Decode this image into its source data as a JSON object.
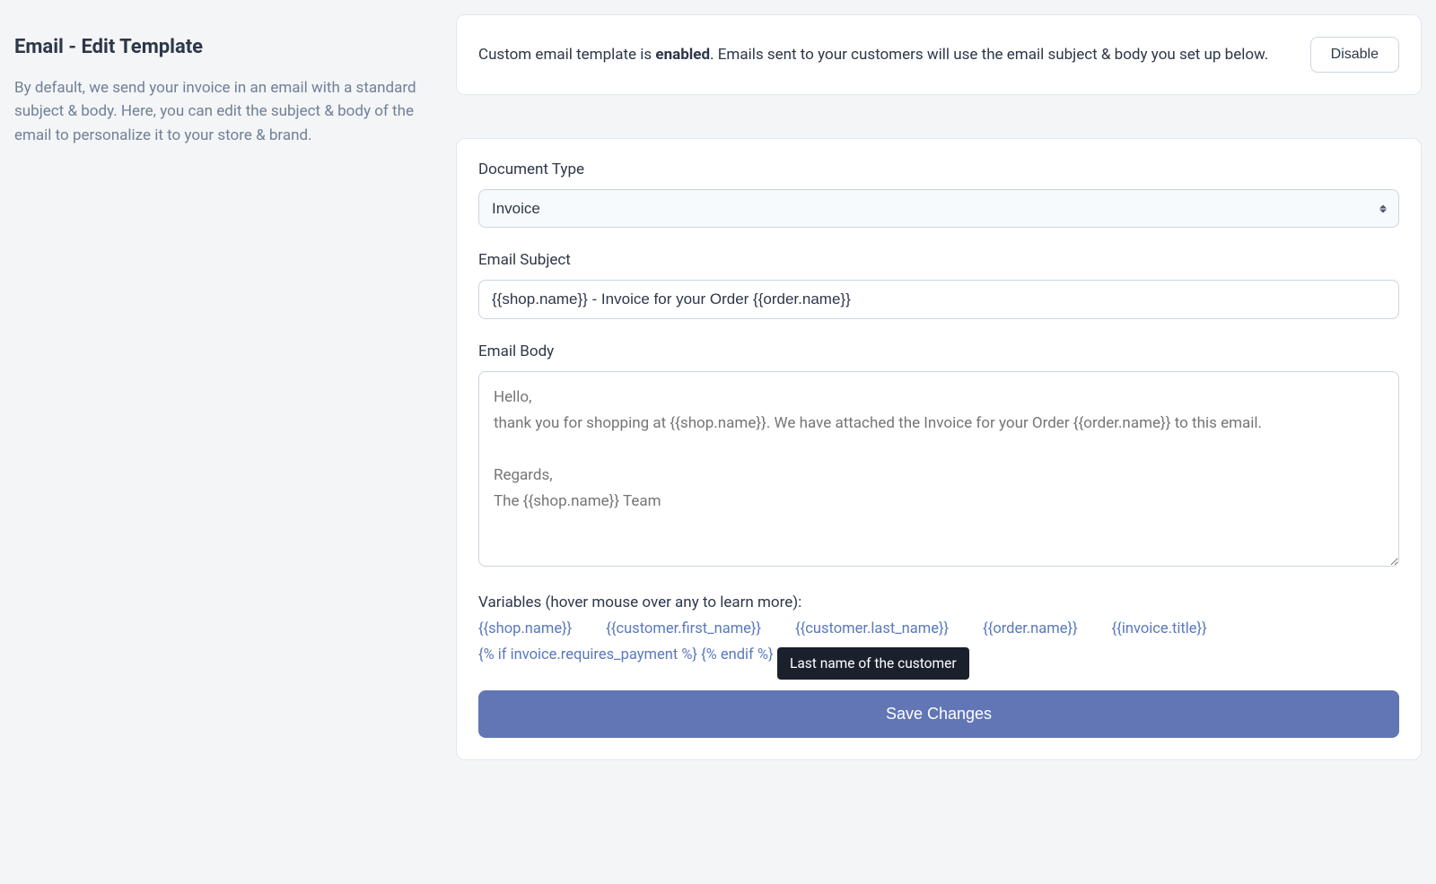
{
  "sidebar": {
    "title": "Email - Edit Template",
    "description": "By default, we send your invoice in an email with a standard subject & body. Here, you can edit the subject & body of the email to personalize it to your store & brand."
  },
  "status": {
    "prefix": "Custom email template is ",
    "enabled_word": "enabled",
    "suffix": ". Emails sent to your customers will use the email subject & body you set up below.",
    "disable_label": "Disable"
  },
  "form": {
    "doc_type_label": "Document Type",
    "doc_type_value": "Invoice",
    "subject_label": "Email Subject",
    "subject_value": "{{shop.name}} - Invoice for your Order {{order.name}}",
    "body_label": "Email Body",
    "body_placeholder": "Hello,\nthank you for shopping at {{shop.name}}. We have attached the Invoice for your Order {{order.name}} to this email.\n\nRegards,\nThe {{shop.name}} Team",
    "variables_label": "Variables (hover mouse over any to learn more):",
    "variables": [
      "{{shop.name}}",
      "{{customer.first_name}}",
      "{{customer.last_name}}",
      "{{order.name}}",
      "{{invoice.title}}",
      "{% if invoice.requires_payment %} {% endif %}"
    ],
    "tooltip_text": "Last name of the customer",
    "save_label": "Save Changes"
  }
}
